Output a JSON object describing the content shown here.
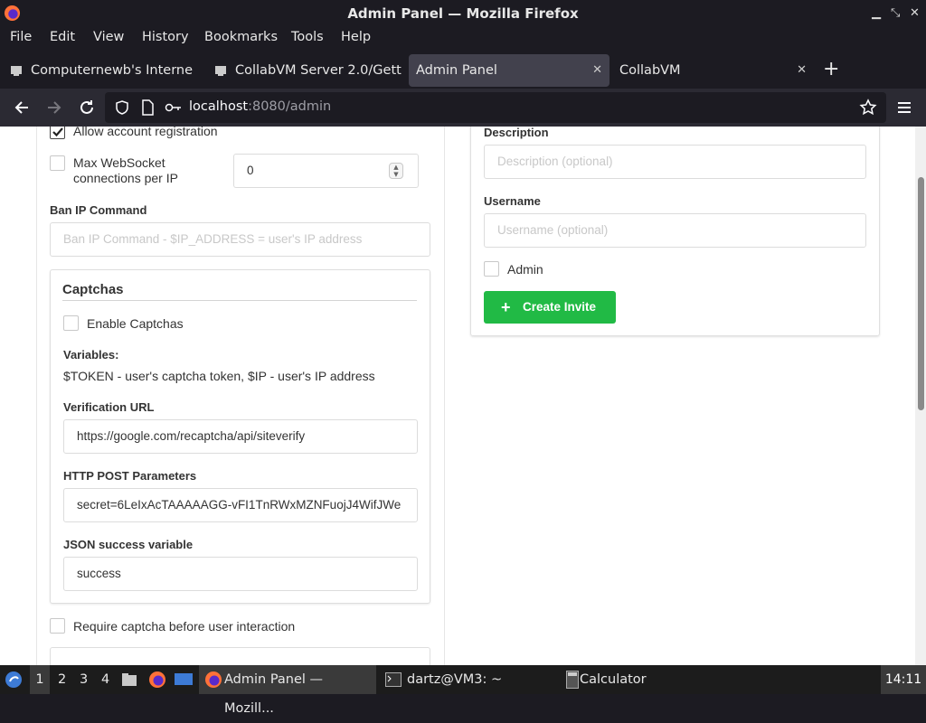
{
  "window": {
    "title": "Admin Panel — Mozilla Firefox"
  },
  "menu": {
    "items": [
      "File",
      "Edit",
      "View",
      "History",
      "Bookmarks",
      "Tools",
      "Help"
    ]
  },
  "tabs": [
    {
      "label": "Computernewb's Interne"
    },
    {
      "label": "CollabVM Server 2.0/Gett"
    },
    {
      "label": "Admin Panel"
    },
    {
      "label": "CollabVM"
    }
  ],
  "url": {
    "host": "localhost",
    "rest": ":8080/admin"
  },
  "left": {
    "allow_registration": "Allow account registration",
    "max_ws_label_1": "Max WebSocket",
    "max_ws_label_2": "connections per IP",
    "max_ws_value": "0",
    "ban_label": "Ban IP Command",
    "ban_placeholder": "Ban IP Command - $IP_ADDRESS = user's IP address",
    "captchas": {
      "heading": "Captchas",
      "enable_label": "Enable Captchas",
      "variables_label": "Variables:",
      "variables_text": "$TOKEN - user's captcha token, $IP - user's IP address",
      "verification_label": "Verification URL",
      "verification_value": "https://google.com/recaptcha/api/siteverify",
      "post_label": "HTTP POST Parameters",
      "post_value": "secret=6LeIxAcTAAAAAGG-vFI1TnRWxMZNFuojJ4WifJWe",
      "json_label": "JSON success variable",
      "json_value": "success"
    },
    "require_captcha": "Require captcha before user interaction"
  },
  "right": {
    "description_label": "Description",
    "description_placeholder": "Description (optional)",
    "username_label": "Username",
    "username_placeholder": "Username (optional)",
    "admin_label": "Admin",
    "create_invite": "Create Invite"
  },
  "taskbar": {
    "workspaces": [
      "1",
      "2",
      "3",
      "4"
    ],
    "tasks": [
      "Admin Panel — Mozill...",
      "dartz@VM3: ~",
      "Calculator"
    ],
    "clock": "14:11"
  }
}
